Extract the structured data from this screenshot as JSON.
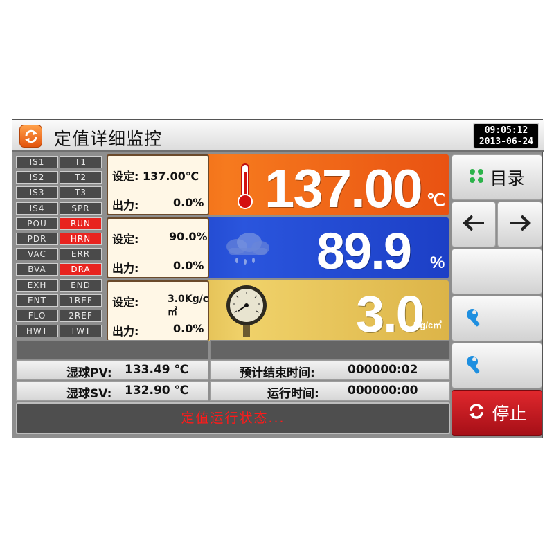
{
  "header": {
    "title": "定值详细监控",
    "time": "09:05:12",
    "date": "2013-06-24"
  },
  "status_tags": [
    {
      "label": "IS1",
      "active": false
    },
    {
      "label": "T1",
      "active": false
    },
    {
      "label": "IS2",
      "active": false
    },
    {
      "label": "T2",
      "active": false
    },
    {
      "label": "IS3",
      "active": false
    },
    {
      "label": "T3",
      "active": false
    },
    {
      "label": "IS4",
      "active": false
    },
    {
      "label": "SPR",
      "active": false
    },
    {
      "label": "POU",
      "active": false
    },
    {
      "label": "RUN",
      "active": true
    },
    {
      "label": "PDR",
      "active": false
    },
    {
      "label": "HRN",
      "active": true
    },
    {
      "label": "VAC",
      "active": false
    },
    {
      "label": "ERR",
      "active": false
    },
    {
      "label": "BVA",
      "active": false
    },
    {
      "label": "DRA",
      "active": true
    },
    {
      "label": "EXH",
      "active": false
    },
    {
      "label": "END",
      "active": false
    },
    {
      "label": "ENT",
      "active": false
    },
    {
      "label": "1REF",
      "active": false
    },
    {
      "label": "FLO",
      "active": false
    },
    {
      "label": "2REF",
      "active": false
    },
    {
      "label": "HWT",
      "active": false
    },
    {
      "label": "TWT",
      "active": false
    }
  ],
  "temperature": {
    "set_label": "设定:",
    "set_value": "137.00℃",
    "output_label": "出力:",
    "output_value": "0.0%",
    "value": "137.00",
    "unit": "℃",
    "icon": "thermometer-icon"
  },
  "humidity": {
    "set_label": "设定:",
    "set_value": "90.0%",
    "output_label": "出力:",
    "output_value": "0.0%",
    "value": "89.9",
    "unit": "%",
    "icon": "cloud-rain-icon"
  },
  "pressure": {
    "set_label": "设定:",
    "set_value": "3.0Kg/c㎡",
    "output_label": "出力:",
    "output_value": "0.0%",
    "value": "3.0",
    "unit": "Kg/c㎡",
    "icon": "pressure-gauge-icon"
  },
  "info": {
    "wet_pv_label": "湿球PV:",
    "wet_pv_value": "133.49 ℃",
    "wet_sv_label": "湿球SV:",
    "wet_sv_value": "132.90 ℃",
    "est_end_label": "预计结束时间:",
    "est_end_value": "000000:02",
    "run_time_label": "运行时间:",
    "run_time_value": "000000:00"
  },
  "status_message": "定值运行状态...",
  "buttons": {
    "menu_label": "目录",
    "stop_label": "停止"
  },
  "colors": {
    "temp_band": "#f06a18",
    "hum_band": "#2448d0",
    "pres_band": "#e2bd52",
    "active_tag": "#e8231f",
    "stop_button": "#c81a20",
    "status_text": "#ff1a1a"
  }
}
